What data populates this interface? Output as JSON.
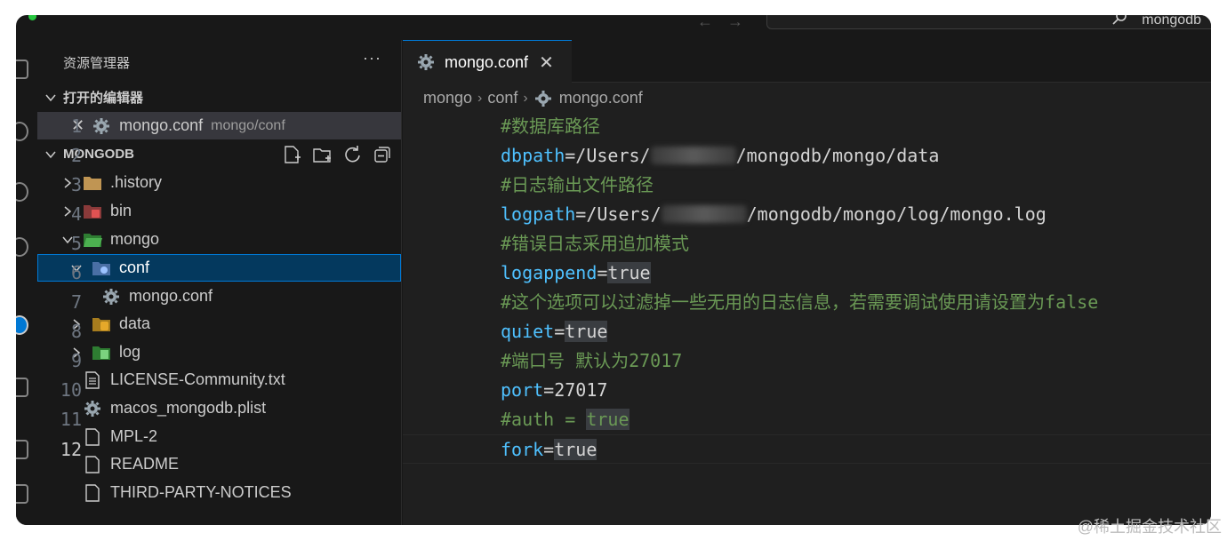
{
  "titlebar": {
    "search_text": "mongodb"
  },
  "sidebar": {
    "title": "资源管理器",
    "more": "···",
    "open_editors_label": "打开的编辑器",
    "open_editor_file": "mongo.conf",
    "open_editor_path": "mongo/conf",
    "folder_label": "MONGODB",
    "tree": [
      {
        "label": ".history"
      },
      {
        "label": "bin"
      },
      {
        "label": "mongo"
      },
      {
        "label": "conf"
      },
      {
        "label": "mongo.conf"
      },
      {
        "label": "data"
      },
      {
        "label": "log"
      },
      {
        "label": "LICENSE-Community.txt"
      },
      {
        "label": "macos_mongodb.plist"
      },
      {
        "label": "MPL-2"
      },
      {
        "label": "README"
      },
      {
        "label": "THIRD-PARTY-NOTICES"
      }
    ]
  },
  "editor": {
    "tab_label": "mongo.conf",
    "breadcrumb": [
      "mongo",
      "conf",
      "mongo.conf"
    ],
    "lines": [
      {
        "num": "1",
        "a": "#数据库路径"
      },
      {
        "num": "2",
        "a": "dbpath",
        "b": "=/Users/",
        "c": "/mongodb/mongo/data"
      },
      {
        "num": "3",
        "a": "#日志输出文件路径"
      },
      {
        "num": "4",
        "a": "logpath",
        "b": "=/Users/",
        "c": "/mongodb/mongo/log/mongo.log"
      },
      {
        "num": "5",
        "a": "#错误日志采用追加模式"
      },
      {
        "num": "6",
        "a": "logappend",
        "b": "=",
        "c": "true"
      },
      {
        "num": "7",
        "a": "#这个选项可以过滤掉一些无用的日志信息，若需要调试使用请设置为false"
      },
      {
        "num": "8",
        "a": "quiet",
        "b": "=",
        "c": "true"
      },
      {
        "num": "9",
        "a": "#端口号 默认为27017"
      },
      {
        "num": "10",
        "a": "port",
        "b": "=27017"
      },
      {
        "num": "11",
        "a": "#auth = ",
        "b": "true"
      },
      {
        "num": "12",
        "a": "fork",
        "b": "=",
        "c": "true"
      }
    ]
  },
  "watermark": "@稀土掘金技术社区",
  "colors": {
    "accent": "#0078d4",
    "comment": "#6a9955",
    "key": "#4fc1ff",
    "folder_mongo": "#4caf50",
    "folder_bin": "#e05252",
    "folder_data": "#e5a82a",
    "folder_history": "#c09553"
  }
}
